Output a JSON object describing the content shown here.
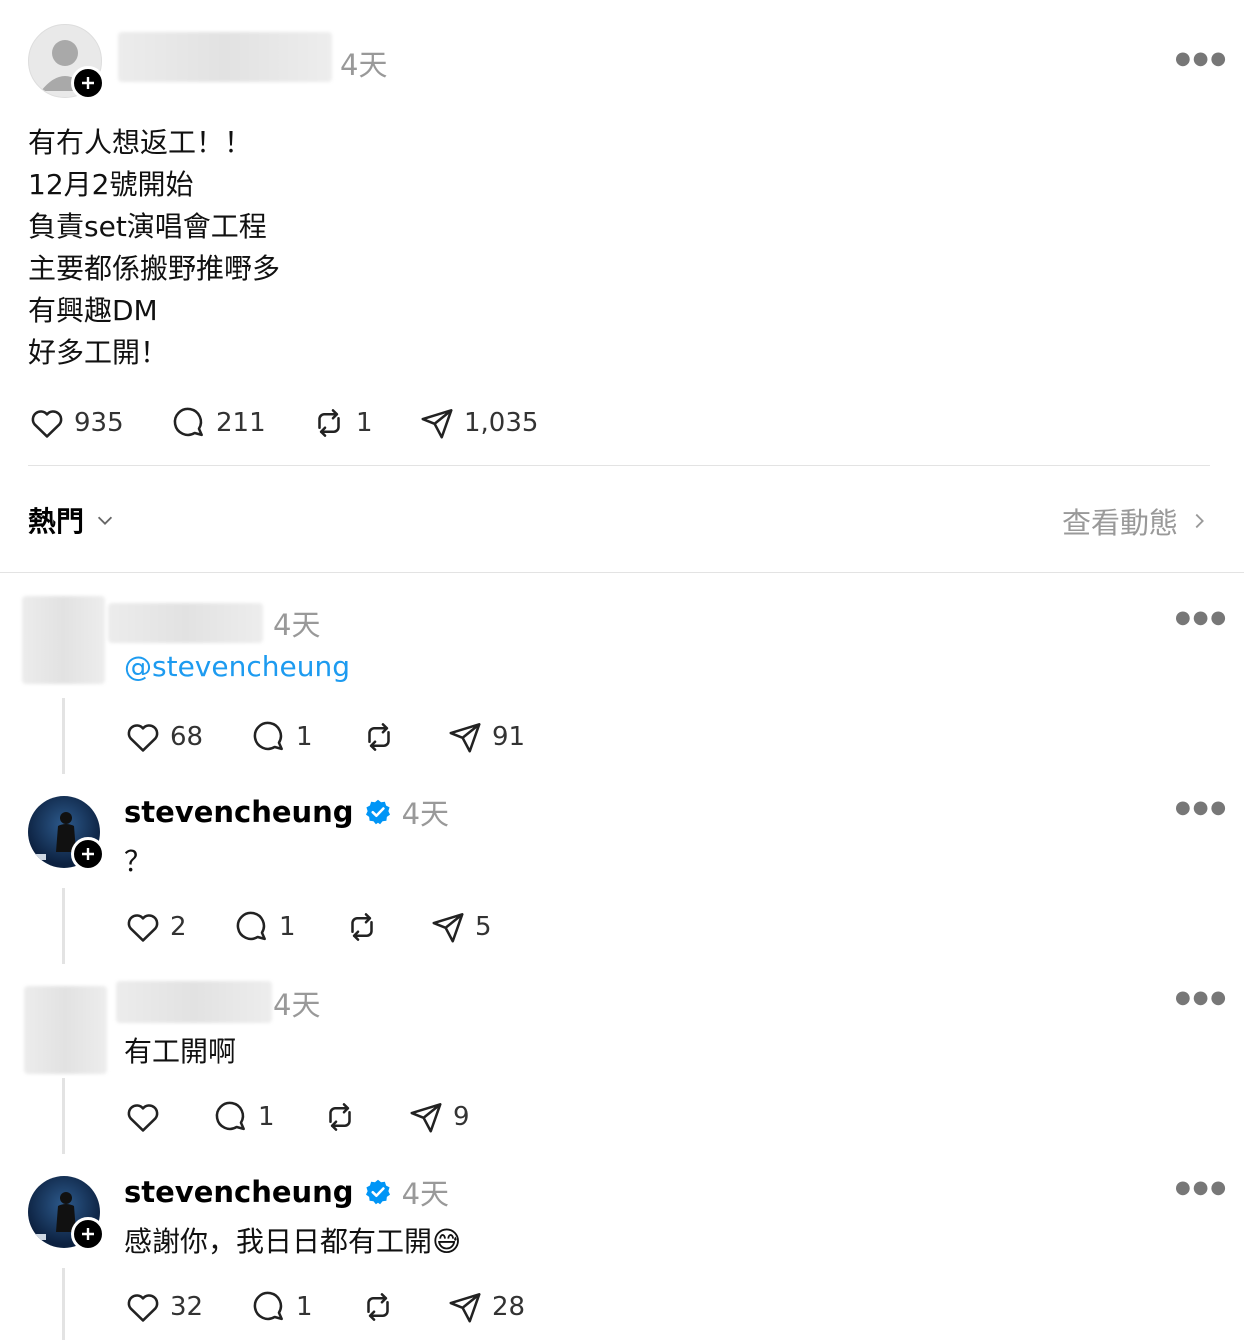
{
  "post": {
    "time": "4天",
    "lines": [
      "有冇人想返工！！",
      "12月2號開始",
      "負責set演唱會工程",
      "主要都係搬野推嘢多",
      "有興趣DM",
      "好多工開！"
    ],
    "likes": "935",
    "comments": "211",
    "reposts": "1",
    "shares": "1,035"
  },
  "sort": {
    "label": "熱門",
    "activity_link": "查看動態"
  },
  "replies": [
    {
      "time": "4天",
      "text": "@stevencheung",
      "likes": "68",
      "comments": "1",
      "reposts": "",
      "shares": "91"
    },
    {
      "username": "stevencheung",
      "time": "4天",
      "text": "？",
      "likes": "2",
      "comments": "1",
      "reposts": "",
      "shares": "5"
    },
    {
      "time": "4天",
      "text": "有工開啊",
      "likes": "",
      "comments": "1",
      "reposts": "",
      "shares": "9"
    },
    {
      "username": "stevencheung",
      "time": "4天",
      "text": "感謝你，我日日都有工開😅",
      "likes": "32",
      "comments": "1",
      "reposts": "",
      "shares": "28"
    }
  ],
  "colors": {
    "mention": "#1d9bf0",
    "verified": "#0095f6",
    "muted": "#999999",
    "divider": "#e3e3e3"
  },
  "icons": [
    "heart-icon",
    "comment-icon",
    "repost-icon",
    "send-icon",
    "more-icon",
    "verified-badge-icon",
    "plus-icon",
    "chevron-down-icon",
    "chevron-right-icon"
  ]
}
